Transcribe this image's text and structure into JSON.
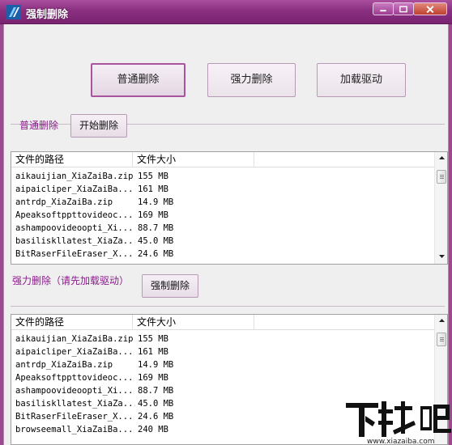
{
  "window": {
    "title": "强制删除",
    "controls": [
      "minimize-icon",
      "maximize-icon",
      "close-icon"
    ]
  },
  "toolbar": {
    "normal_delete_label": "普通删除",
    "force_delete_label": "强力删除",
    "load_driver_label": "加载驱动"
  },
  "normal_section": {
    "label": "普通删除",
    "start_button": "开始删除",
    "columns": [
      "文件的路径",
      "文件大小"
    ],
    "rows": [
      {
        "path": "aikauijian_XiaZaiBa.zip",
        "size": "155 MB"
      },
      {
        "path": "aipaicliper_XiaZaiBa...",
        "size": "161 MB"
      },
      {
        "path": "antrdp_XiaZaiBa.zip",
        "size": "14.9 MB"
      },
      {
        "path": "Apeaksoftppttovideoc...",
        "size": "169 MB"
      },
      {
        "path": "ashampoovideoopti_Xi...",
        "size": "88.7 MB"
      },
      {
        "path": "basiliskllatest_XiaZa...",
        "size": "45.0 MB"
      },
      {
        "path": "BitRaserFileEraser_X...",
        "size": "24.6 MB"
      }
    ]
  },
  "force_section": {
    "label": "强力删除（请先加载驱动）",
    "force_button": "强制删除",
    "columns": [
      "文件的路径",
      "文件大小"
    ],
    "rows": [
      {
        "path": "aikauijian_XiaZaiBa.zip",
        "size": "155 MB"
      },
      {
        "path": "aipaicliper_XiaZaiBa...",
        "size": "161 MB"
      },
      {
        "path": "antrdp_XiaZaiBa.zip",
        "size": "14.9 MB"
      },
      {
        "path": "Apeaksoftppttovideoc...",
        "size": "169 MB"
      },
      {
        "path": "ashampoovideoopti_Xi...",
        "size": "88.7 MB"
      },
      {
        "path": "basiliskllatest_XiaZa...",
        "size": "45.0 MB"
      },
      {
        "path": "BitRaserFileEraser_X...",
        "size": "24.6 MB"
      },
      {
        "path": "browseemall_XiaZaiBa...",
        "size": "240 MB"
      }
    ]
  },
  "watermark": {
    "brand": "下载吧",
    "url": "www.xiazaiba.com"
  },
  "colors": {
    "titlebar": "#8a2f80",
    "accent_text": "#8a1c8a",
    "client_bg": "#efefef"
  }
}
